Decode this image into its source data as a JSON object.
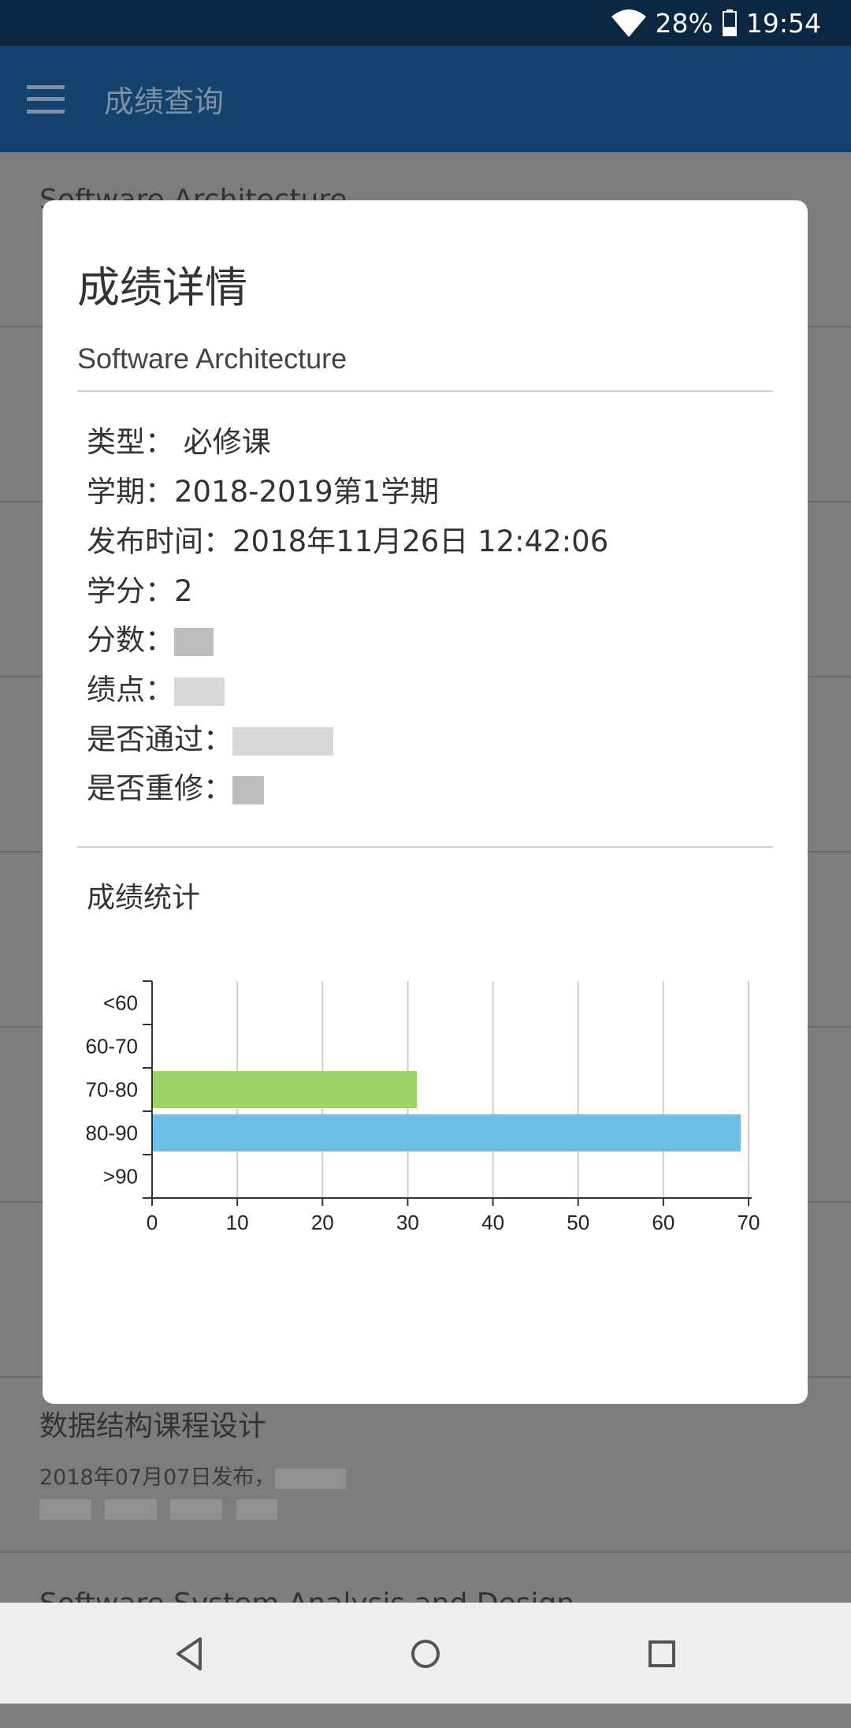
{
  "status_bar": {
    "battery": "28%",
    "time": "19:54"
  },
  "app_bar": {
    "title": "成绩查询",
    "menu_icon": "hamburger-menu-icon"
  },
  "background_list": [
    {
      "title": "Software Architecture"
    },
    {
      "title": "数据结构课程设计",
      "subtitle": "2018年07月07日发布，"
    },
    {
      "title": "Software System Analysis and Design"
    }
  ],
  "dialog": {
    "title": "成绩详情",
    "course": "Software Architecture",
    "details": [
      {
        "label": "类型：",
        "value": " 必修课"
      },
      {
        "label": "学期：",
        "value": "2018-2019第1学期"
      },
      {
        "label": "发布时间：",
        "value": "2018年11月26日 12:42:06"
      },
      {
        "label": "学分：",
        "value": "2"
      },
      {
        "label": "分数：",
        "value": ""
      },
      {
        "label": "绩点：",
        "value": ""
      },
      {
        "label": "是否通过：",
        "value": ""
      },
      {
        "label": "是否重修：",
        "value": ""
      }
    ],
    "stats_title": "成绩统计"
  },
  "chart_data": {
    "type": "bar",
    "orientation": "horizontal",
    "categories": [
      "<60",
      "60-70",
      "70-80",
      "80-90",
      ">90"
    ],
    "values": [
      0,
      0,
      31,
      69,
      0
    ],
    "bar_colors": {
      "70-80": "#9ed466",
      "80-90": "#6bc0e8"
    },
    "xlim": [
      0,
      70
    ],
    "x_ticks": [
      0,
      10,
      20,
      30,
      40,
      50,
      60,
      70
    ],
    "grid": true
  },
  "nav_bar": {
    "back_icon": "back-triangle-icon",
    "home_icon": "home-circle-icon",
    "recents_icon": "recents-square-icon"
  }
}
